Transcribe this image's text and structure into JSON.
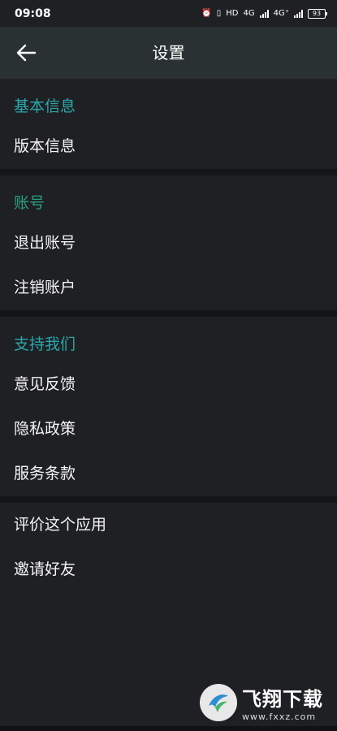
{
  "status_bar": {
    "time": "09:08",
    "network_1": "4G",
    "network_2": "4G⁺",
    "hd": "HD",
    "battery": "93"
  },
  "app_bar": {
    "title": "设置",
    "back_icon": "arrow-left-icon"
  },
  "sections": [
    {
      "header": "基本信息",
      "items": [
        "版本信息"
      ]
    },
    {
      "header": "账号",
      "items": [
        "退出账号",
        "注销账户"
      ]
    },
    {
      "header": "支持我们",
      "items": [
        "意见反馈",
        "隐私政策",
        "服务条款"
      ]
    },
    {
      "header": "",
      "items": [
        "评价这个应用",
        "邀请好友"
      ]
    }
  ],
  "watermark": {
    "cn": "飞翔下载",
    "url": "www.fxxz.com"
  },
  "colors": {
    "background": "#1f2023",
    "app_bar": "#2a3133",
    "accent_teal": "#29a8ab",
    "accent_green": "#27a082"
  }
}
